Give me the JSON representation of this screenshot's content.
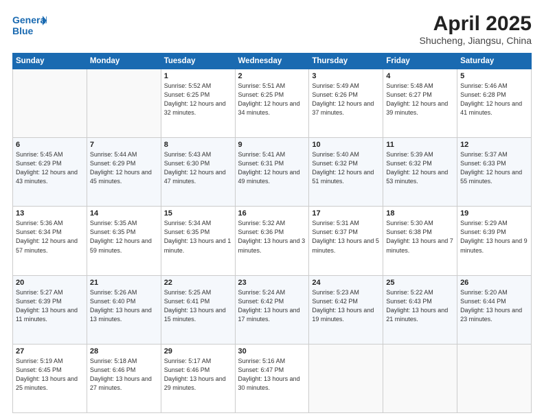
{
  "header": {
    "logo_line1": "General",
    "logo_line2": "Blue",
    "month": "April 2025",
    "location": "Shucheng, Jiangsu, China"
  },
  "weekdays": [
    "Sunday",
    "Monday",
    "Tuesday",
    "Wednesday",
    "Thursday",
    "Friday",
    "Saturday"
  ],
  "weeks": [
    [
      {
        "num": "",
        "info": ""
      },
      {
        "num": "",
        "info": ""
      },
      {
        "num": "1",
        "info": "Sunrise: 5:52 AM\nSunset: 6:25 PM\nDaylight: 12 hours and 32 minutes."
      },
      {
        "num": "2",
        "info": "Sunrise: 5:51 AM\nSunset: 6:25 PM\nDaylight: 12 hours and 34 minutes."
      },
      {
        "num": "3",
        "info": "Sunrise: 5:49 AM\nSunset: 6:26 PM\nDaylight: 12 hours and 37 minutes."
      },
      {
        "num": "4",
        "info": "Sunrise: 5:48 AM\nSunset: 6:27 PM\nDaylight: 12 hours and 39 minutes."
      },
      {
        "num": "5",
        "info": "Sunrise: 5:46 AM\nSunset: 6:28 PM\nDaylight: 12 hours and 41 minutes."
      }
    ],
    [
      {
        "num": "6",
        "info": "Sunrise: 5:45 AM\nSunset: 6:29 PM\nDaylight: 12 hours and 43 minutes."
      },
      {
        "num": "7",
        "info": "Sunrise: 5:44 AM\nSunset: 6:29 PM\nDaylight: 12 hours and 45 minutes."
      },
      {
        "num": "8",
        "info": "Sunrise: 5:43 AM\nSunset: 6:30 PM\nDaylight: 12 hours and 47 minutes."
      },
      {
        "num": "9",
        "info": "Sunrise: 5:41 AM\nSunset: 6:31 PM\nDaylight: 12 hours and 49 minutes."
      },
      {
        "num": "10",
        "info": "Sunrise: 5:40 AM\nSunset: 6:32 PM\nDaylight: 12 hours and 51 minutes."
      },
      {
        "num": "11",
        "info": "Sunrise: 5:39 AM\nSunset: 6:32 PM\nDaylight: 12 hours and 53 minutes."
      },
      {
        "num": "12",
        "info": "Sunrise: 5:37 AM\nSunset: 6:33 PM\nDaylight: 12 hours and 55 minutes."
      }
    ],
    [
      {
        "num": "13",
        "info": "Sunrise: 5:36 AM\nSunset: 6:34 PM\nDaylight: 12 hours and 57 minutes."
      },
      {
        "num": "14",
        "info": "Sunrise: 5:35 AM\nSunset: 6:35 PM\nDaylight: 12 hours and 59 minutes."
      },
      {
        "num": "15",
        "info": "Sunrise: 5:34 AM\nSunset: 6:35 PM\nDaylight: 13 hours and 1 minute."
      },
      {
        "num": "16",
        "info": "Sunrise: 5:32 AM\nSunset: 6:36 PM\nDaylight: 13 hours and 3 minutes."
      },
      {
        "num": "17",
        "info": "Sunrise: 5:31 AM\nSunset: 6:37 PM\nDaylight: 13 hours and 5 minutes."
      },
      {
        "num": "18",
        "info": "Sunrise: 5:30 AM\nSunset: 6:38 PM\nDaylight: 13 hours and 7 minutes."
      },
      {
        "num": "19",
        "info": "Sunrise: 5:29 AM\nSunset: 6:39 PM\nDaylight: 13 hours and 9 minutes."
      }
    ],
    [
      {
        "num": "20",
        "info": "Sunrise: 5:27 AM\nSunset: 6:39 PM\nDaylight: 13 hours and 11 minutes."
      },
      {
        "num": "21",
        "info": "Sunrise: 5:26 AM\nSunset: 6:40 PM\nDaylight: 13 hours and 13 minutes."
      },
      {
        "num": "22",
        "info": "Sunrise: 5:25 AM\nSunset: 6:41 PM\nDaylight: 13 hours and 15 minutes."
      },
      {
        "num": "23",
        "info": "Sunrise: 5:24 AM\nSunset: 6:42 PM\nDaylight: 13 hours and 17 minutes."
      },
      {
        "num": "24",
        "info": "Sunrise: 5:23 AM\nSunset: 6:42 PM\nDaylight: 13 hours and 19 minutes."
      },
      {
        "num": "25",
        "info": "Sunrise: 5:22 AM\nSunset: 6:43 PM\nDaylight: 13 hours and 21 minutes."
      },
      {
        "num": "26",
        "info": "Sunrise: 5:20 AM\nSunset: 6:44 PM\nDaylight: 13 hours and 23 minutes."
      }
    ],
    [
      {
        "num": "27",
        "info": "Sunrise: 5:19 AM\nSunset: 6:45 PM\nDaylight: 13 hours and 25 minutes."
      },
      {
        "num": "28",
        "info": "Sunrise: 5:18 AM\nSunset: 6:46 PM\nDaylight: 13 hours and 27 minutes."
      },
      {
        "num": "29",
        "info": "Sunrise: 5:17 AM\nSunset: 6:46 PM\nDaylight: 13 hours and 29 minutes."
      },
      {
        "num": "30",
        "info": "Sunrise: 5:16 AM\nSunset: 6:47 PM\nDaylight: 13 hours and 30 minutes."
      },
      {
        "num": "",
        "info": ""
      },
      {
        "num": "",
        "info": ""
      },
      {
        "num": "",
        "info": ""
      }
    ]
  ]
}
